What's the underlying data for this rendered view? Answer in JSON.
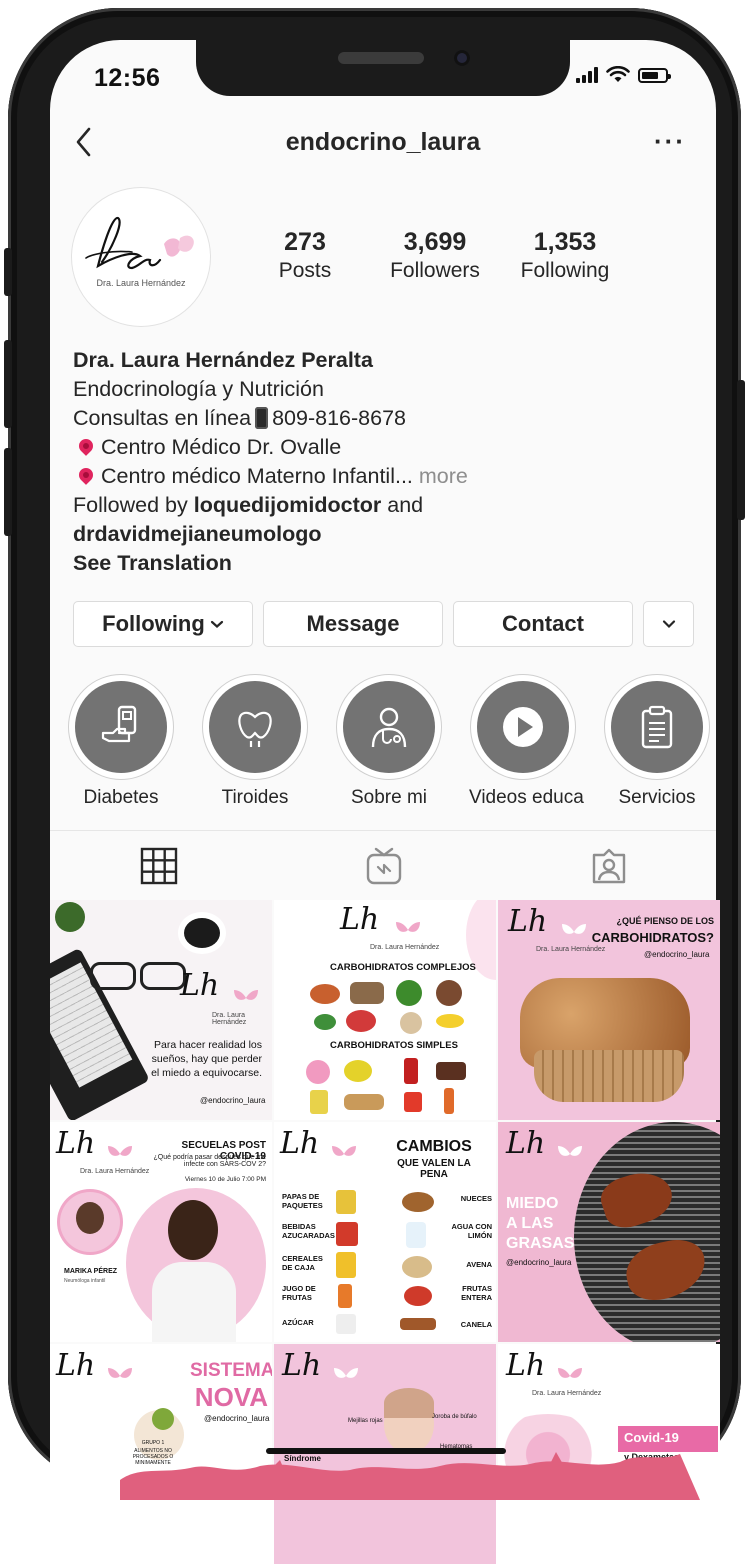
{
  "status_bar": {
    "time": "12:56"
  },
  "header": {
    "username": "endocrino_laura"
  },
  "profile": {
    "avatar_caption": "Dra. Laura Hernández",
    "stats": [
      {
        "value": "273",
        "label": "Posts"
      },
      {
        "value": "3,699",
        "label": "Followers"
      },
      {
        "value": "1,353",
        "label": "Following"
      }
    ],
    "bio": {
      "name": "Dra. Laura Hernández Peralta",
      "line1": "Endocrinología y Nutrición",
      "line2_a": "Consultas en línea",
      "line2_b": "809-816-8678",
      "line3": "Centro Médico Dr. Ovalle",
      "line4": "Centro médico Materno Infantil...",
      "more": "more",
      "followed_prefix": "Followed by",
      "followed_user1": "loquedijomidoctor",
      "followed_and": "and",
      "followed_user2": "drdavidmejianeumologo",
      "see_translation": "See Translation"
    }
  },
  "actions": {
    "following": "Following",
    "message": "Message",
    "contact": "Contact"
  },
  "highlights": [
    {
      "label": "Diabetes",
      "icon": "glucometer-icon"
    },
    {
      "label": "Tiroides",
      "icon": "thyroid-icon"
    },
    {
      "label": "Sobre mi",
      "icon": "doctor-icon"
    },
    {
      "label": "Videos educa",
      "icon": "play-icon"
    },
    {
      "label": "Servicios",
      "icon": "clipboard-icon"
    }
  ],
  "posts": {
    "p1": {
      "text": "Para hacer realidad los sueños, hay que perder el miedo a equivocarse.",
      "handle": "@endocrino_laura"
    },
    "p2": {
      "title1": "CARBOHIDRATOS COMPLEJOS",
      "title2": "CARBOHIDRATOS SIMPLES"
    },
    "p3": {
      "title1": "¿QUÉ PIENSO DE LOS",
      "title2": "CARBOHIDRATOS?",
      "handle": "@endocrino_laura"
    },
    "p4": {
      "title": "SECUELAS POST COVID-19",
      "sub": "¿Qué podría pasar después que me infecte con SARS-COV 2?",
      "date": "Viernes 10 de Julio 7:00 PM",
      "person": "MARIKA PÉREZ",
      "role": "Neumóloga infantil"
    },
    "p5": {
      "title1": "CAMBIOS",
      "title2": "QUE VALEN LA PENA",
      "left": [
        "PAPAS DE PAQUETES",
        "BEBIDAS AZUCARADAS",
        "CEREALES DE CAJA",
        "JUGO DE FRUTAS",
        "AZÚCAR"
      ],
      "right": [
        "NUECES",
        "AGUA CON LIMÓN",
        "AVENA",
        "FRUTAS ENTERA",
        "CANELA"
      ]
    },
    "p6": {
      "title": "MIEDO A LAS GRASAS",
      "handle": "@endocrino_laura"
    },
    "p7": {
      "title1": "SISTEMA",
      "title2": "NOVA",
      "handle": "@endocrino_laura",
      "group": "GRUPO 1",
      "group_text": "ALIMENTOS NO PROCESADOS O MINIMAMENTE"
    },
    "p8": {
      "label1": "Mejillas rojas",
      "label2": "Joroba de búfalo",
      "label3": "Síndrome",
      "label4": "Hematomas"
    },
    "p9": {
      "title": "Covid-19",
      "sub": "y Dexametas"
    }
  },
  "signature": {
    "mark": "Lh",
    "name": "Dra. Laura Hernández"
  },
  "colors": {
    "accent_pink": "#f2c4dc",
    "post_pink": "#f0b8d2",
    "brand_magenta": "#e86aa6",
    "text_dark": "#262626",
    "muted": "#8e8e8e"
  }
}
